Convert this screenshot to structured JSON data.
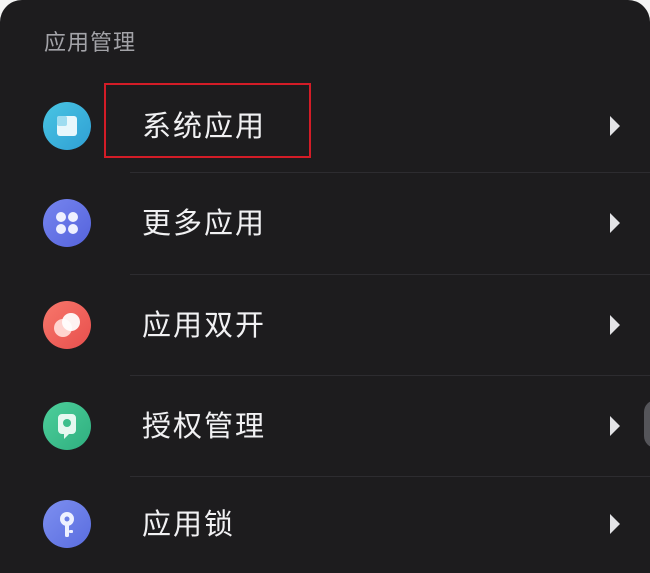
{
  "section": {
    "title": "应用管理"
  },
  "menu": {
    "items": [
      {
        "label": "系统应用",
        "icon": "system-apps-icon",
        "color": "#3ab7dc"
      },
      {
        "label": "更多应用",
        "icon": "more-apps-icon",
        "color": "#6775e6"
      },
      {
        "label": "应用双开",
        "icon": "app-twin-icon",
        "color": "#f0625a"
      },
      {
        "label": "授权管理",
        "icon": "permission-icon",
        "color": "#3fc08d"
      },
      {
        "label": "应用锁",
        "icon": "app-lock-icon",
        "color": "#6d80e8"
      }
    ]
  },
  "colors": {
    "background": "#1d1c1e",
    "highlight": "#d31c27"
  }
}
